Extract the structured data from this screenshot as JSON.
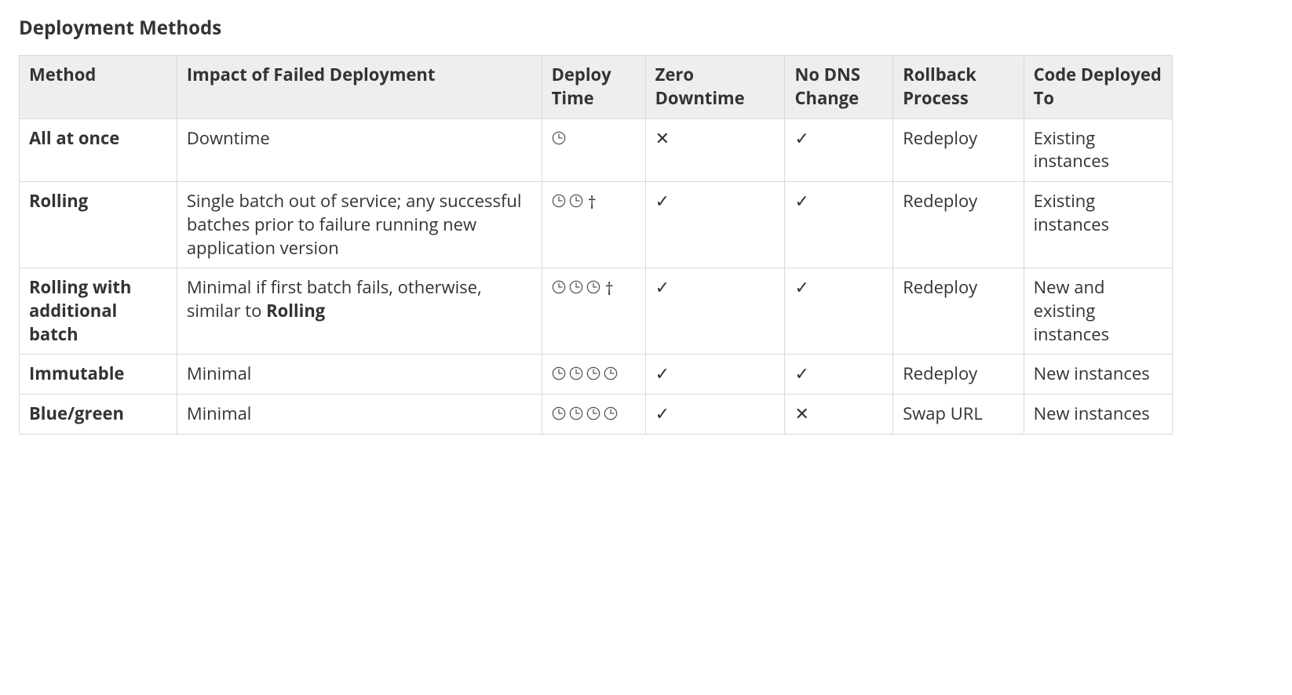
{
  "title": "Deployment Methods",
  "symbols": {
    "check": "✓",
    "x": "✕",
    "dagger": "†"
  },
  "headers": [
    "Method",
    "Impact of Failed Deployment",
    "Deploy Time",
    "Zero Downtime",
    "No DNS Change",
    "Rollback Process",
    "Code Deployed To"
  ],
  "rows": [
    {
      "method": "All at once",
      "impact_pre": "Downtime",
      "impact_bold": "",
      "impact_post": "",
      "clocks": 1,
      "time_dagger": false,
      "zero_downtime": "x",
      "no_dns_change": "check",
      "rollback": "Redeploy",
      "deployed_to": "Existing instances"
    },
    {
      "method": "Rolling",
      "impact_pre": "Single batch out of service; any successful batches prior to failure running new application version",
      "impact_bold": "",
      "impact_post": "",
      "clocks": 2,
      "time_dagger": true,
      "zero_downtime": "check",
      "no_dns_change": "check",
      "rollback": "Redeploy",
      "deployed_to": "Existing instances"
    },
    {
      "method": "Rolling with additional batch",
      "impact_pre": "Minimal if first batch fails, otherwise, similar to ",
      "impact_bold": "Rolling",
      "impact_post": "",
      "clocks": 3,
      "time_dagger": true,
      "zero_downtime": "check",
      "no_dns_change": "check",
      "rollback": "Redeploy",
      "deployed_to": "New and existing instances"
    },
    {
      "method": "Immutable",
      "impact_pre": "Minimal",
      "impact_bold": "",
      "impact_post": "",
      "clocks": 4,
      "time_dagger": false,
      "zero_downtime": "check",
      "no_dns_change": "check",
      "rollback": "Redeploy",
      "deployed_to": "New instances"
    },
    {
      "method": "Blue/green",
      "impact_pre": "Minimal",
      "impact_bold": "",
      "impact_post": "",
      "clocks": 4,
      "time_dagger": false,
      "zero_downtime": "check",
      "no_dns_change": "x",
      "rollback": "Swap URL",
      "deployed_to": "New instances"
    }
  ]
}
